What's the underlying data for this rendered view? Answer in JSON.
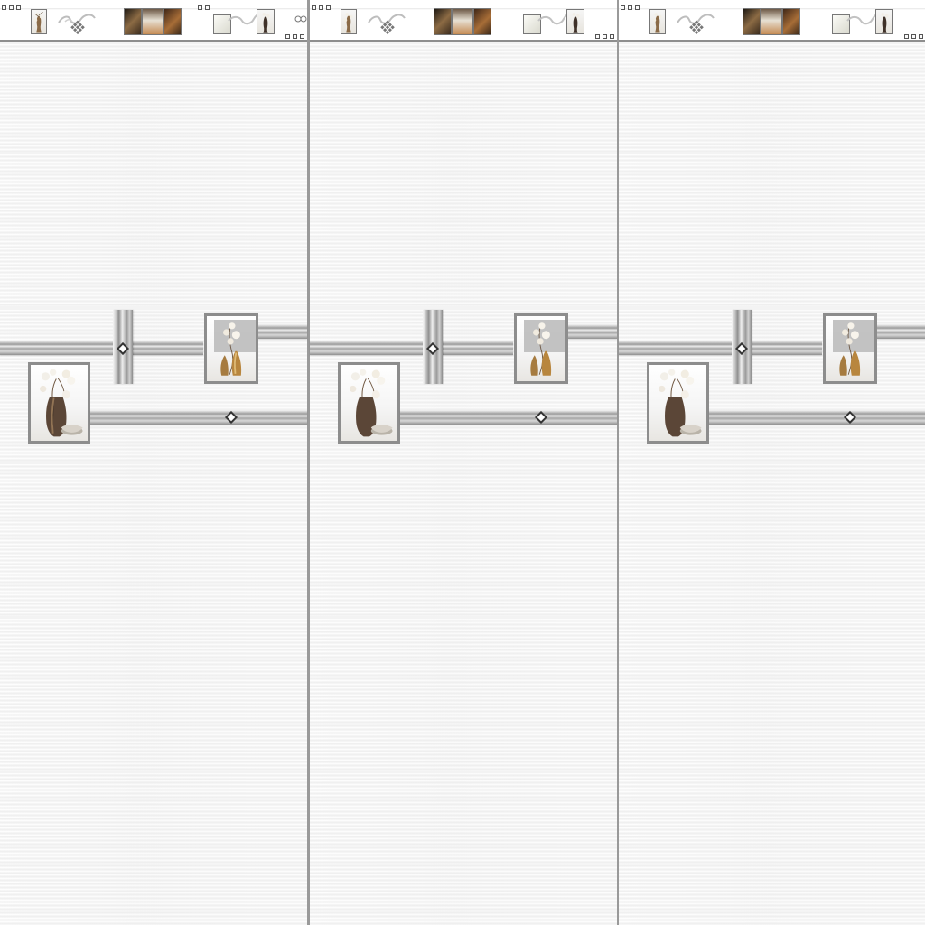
{
  "scene": {
    "columns": [
      {
        "id": "left"
      },
      {
        "id": "center"
      },
      {
        "id": "right"
      }
    ],
    "colors": {
      "grout": "#9a9a9a",
      "tile": "#f3f3f3",
      "metal": "#9b9b9b",
      "accent_dark": "#333333",
      "photo_brown": "#8c6b44"
    }
  }
}
